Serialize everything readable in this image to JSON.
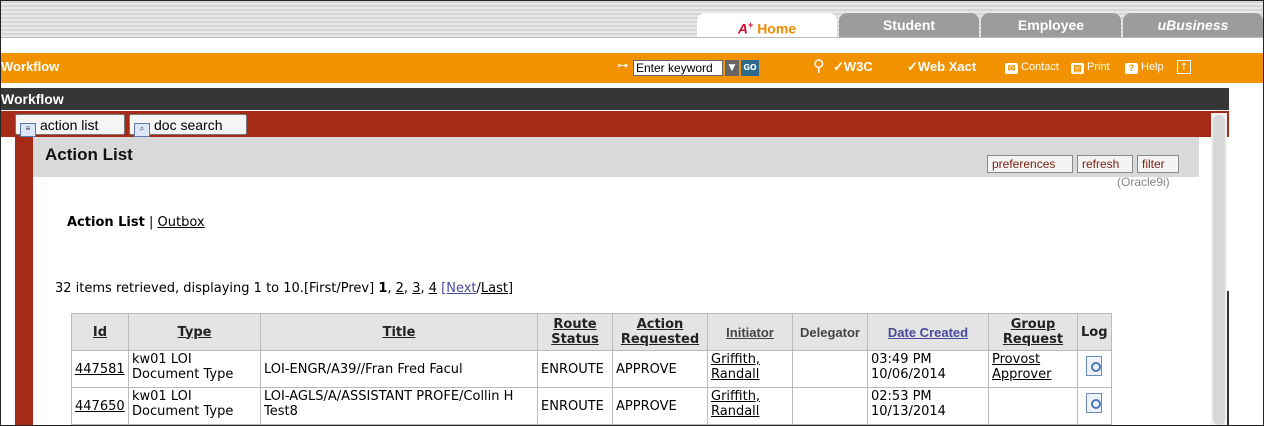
{
  "tabs": {
    "home_prefix": "A",
    "home": "Home",
    "student": "Student",
    "employee": "Employee",
    "ubusiness_u": "u",
    "ubusiness": "Business"
  },
  "orange_bar": {
    "title": "Workflow",
    "keyword_placeholder": "Enter keyword",
    "go_label": "GO",
    "w3c": "W3C",
    "webxact": "Web Xact",
    "contact": "Contact",
    "print": "Print",
    "help": "Help"
  },
  "dark_bar": {
    "title": "Workflow"
  },
  "red_bar": {
    "action_list": "action list",
    "doc_search": "doc search"
  },
  "section": {
    "title": "Action List",
    "preferences": "preferences",
    "refresh": "refresh",
    "filter": "filter",
    "db_note": "(Oracle9i)"
  },
  "view_tabs": {
    "active": "Action List",
    "separator": "|",
    "outbox": "Outbox"
  },
  "paging": {
    "summary": "32 items retrieved, displaying 1 to 10.",
    "first_prev": "[First/Prev]",
    "current": "1",
    "pages": [
      "2",
      "3",
      "4"
    ],
    "next": "[Next",
    "slash": "/",
    "last": "Last",
    "close": "]"
  },
  "table": {
    "headers": {
      "id": "Id",
      "type": "Type",
      "title": "Title",
      "route_status": "Route Status",
      "action_requested": "Action Requested",
      "initiator": "Initiator",
      "delegator": "Delegator",
      "date_created": "Date Created",
      "group_request": "Group Request",
      "log": "Log"
    },
    "rows": [
      {
        "id": "447581",
        "type": "kw01 LOI Document Type",
        "title": "LOI-ENGR/A39//Fran Fred Facul",
        "route_status": "ENROUTE",
        "action_requested": "APPROVE",
        "initiator": "Griffith, Randall",
        "delegator": "",
        "date_created": "03:49 PM 10/06/2014",
        "group_request": "Provost Approver"
      },
      {
        "id": "447650",
        "type": "kw01 LOI Document Type",
        "title": "LOI-AGLS/A/ASSISTANT PROFE/Collin H Test8",
        "route_status": "ENROUTE",
        "action_requested": "APPROVE",
        "initiator": "Griffith, Randall",
        "delegator": "",
        "date_created": "02:53 PM 10/13/2014",
        "group_request": ""
      }
    ]
  }
}
